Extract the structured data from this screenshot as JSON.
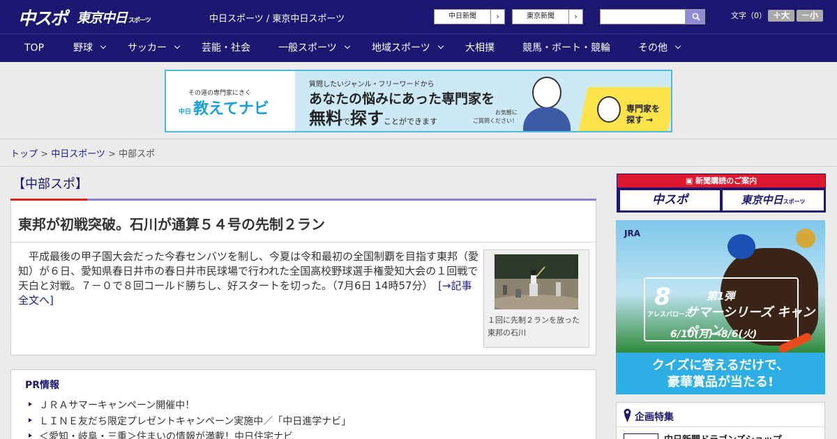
{
  "header": {
    "logo_chunichi_sports": "中スポ",
    "logo_tokyo_chunichi": "東京中日",
    "logo_tokyo_chunichi_suffix": "スポーツ",
    "tagline": "中日スポーツ / 東京中日スポーツ",
    "ext_links": [
      {
        "label": "中日新聞",
        "arrow": "›"
      },
      {
        "label": "東京新聞",
        "arrow": "›"
      }
    ],
    "search_placeholder": "",
    "font_size_label": "文字（0）",
    "font_up": "＋大",
    "font_down": "－小"
  },
  "nav": {
    "items": [
      {
        "label": "TOP"
      },
      {
        "label": "野球"
      },
      {
        "label": "サッカー"
      },
      {
        "label": "芸能・社会"
      },
      {
        "label": "一般スポーツ"
      },
      {
        "label": "地域スポーツ"
      },
      {
        "label": "大相撲"
      },
      {
        "label": "競馬・ボート・競輪"
      },
      {
        "label": "その他"
      }
    ]
  },
  "ad_banner": {
    "sub": "その道の専門家にきく",
    "brand_prefix": "中日",
    "brand": "教えてナビ",
    "line1": "質問したいジャンル・フリーワードから",
    "line2": "あなたの悩みにあった専門家を",
    "line3_a": "無料",
    "line3_b": "で",
    "line3_c": "探す",
    "line3_d": "ことができます",
    "note1": "お気軽に",
    "note2": "ご質問ください！",
    "cta1": "専門家を",
    "cta2": "探す →"
  },
  "breadcrumb": {
    "home": "トップ",
    "sep": " > ",
    "section": "中日スポーツ",
    "current": "中部スポ"
  },
  "section_title": "【中部スポ】",
  "article": {
    "title": "東邦が初戦突破。石川が通算５４号の先制２ラン",
    "body": "平成最後の甲子園大会だった今春センバツを制し、今夏は令和最初の全国制覇を目指す東邦（愛知）が６日、愛知県春日井市の春日井市民球場で行われた全国高校野球選手権愛知大会の１回戦で天白と対戦。７－０で８回コールド勝ちし、好スタートを切った。（7月6日 14時57分）",
    "more": "[→記事全文へ]",
    "photo_caption": "１回に先制２ランを放った東邦の石川"
  },
  "pr": {
    "title": "PR情報",
    "items": [
      "ＪＲＡサマーキャンペーン開催中！",
      "ＬＩＮＥ友だち限定プレゼントキャンペーン実施中／「中日進学ナビ」",
      "＜愛知・岐阜・三重＞住まいの情報が満載！中日住宅ナビ"
    ]
  },
  "sidebar": {
    "subscribe_head": "新聞購読のご案内",
    "subscribe_b1": "中スポ",
    "subscribe_b2": "東京中日",
    "subscribe_b2_suffix": "スポーツ",
    "jra": {
      "logo": "JRA",
      "number": "8",
      "horse_name": "アレスバローズ",
      "campaign_no": "第1弾",
      "campaign": "サマーシリーズ キャンペーン",
      "dates": "6/10(月)→8/6(火)",
      "copy1": "クイズに答えるだけで、",
      "copy2": "豪華賞品が当たる!"
    },
    "feature_title": "企画特集",
    "feature_item": "中日新聞ドラゴンズショップ"
  },
  "colors": {
    "header_bg": "#1c1770",
    "link": "#1c1a90",
    "accent_red": "#d22",
    "banner_border": "#4db8e0"
  }
}
